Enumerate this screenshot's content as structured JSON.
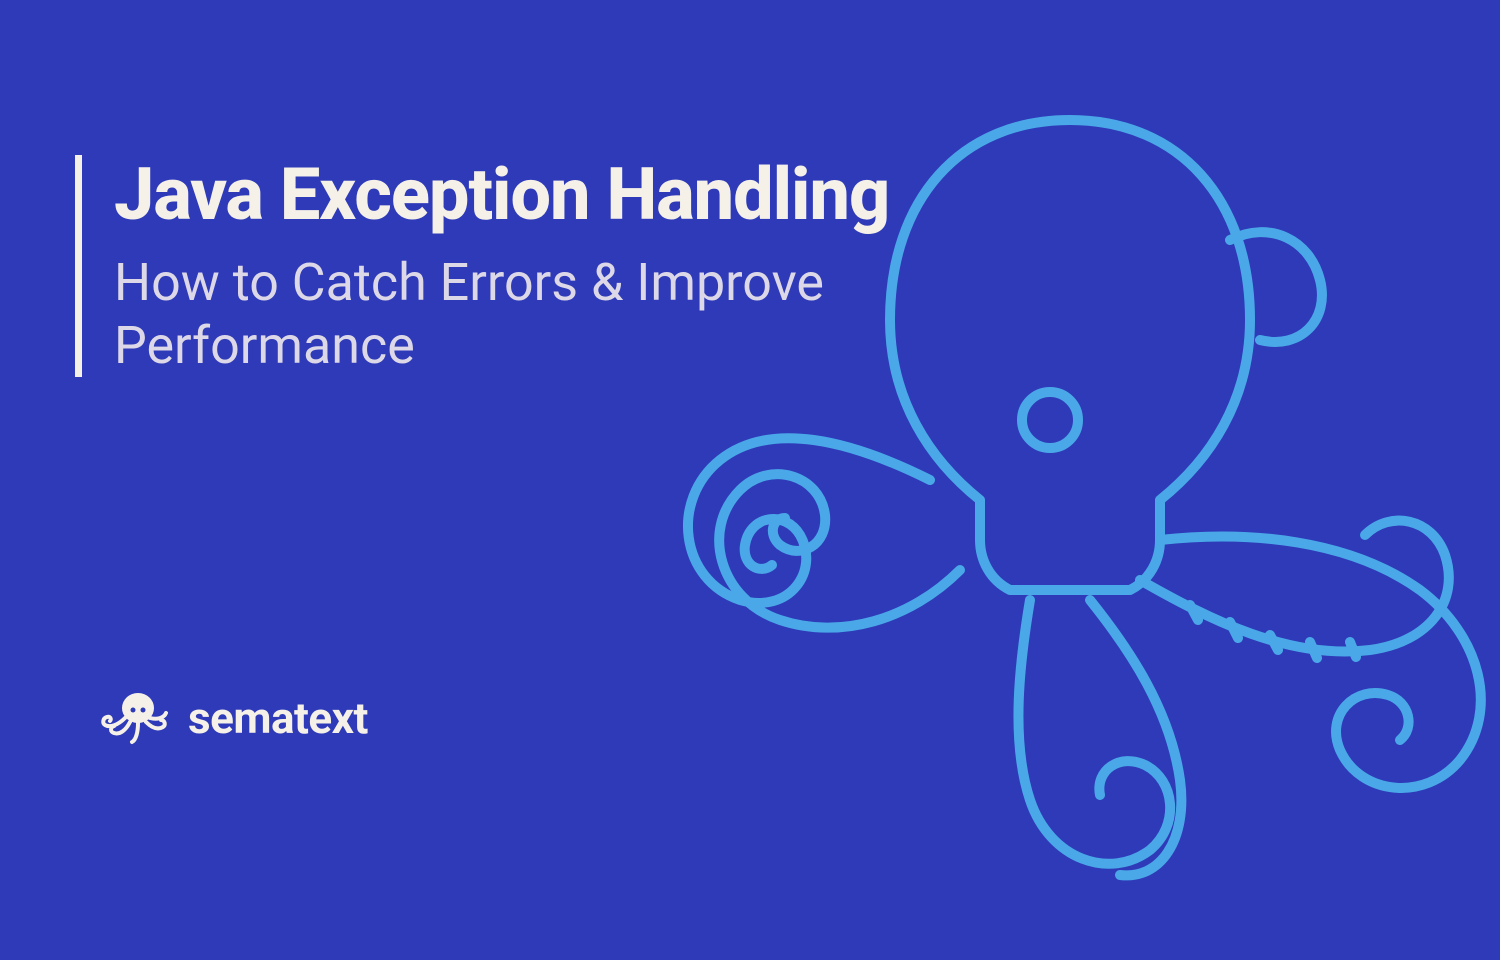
{
  "hero": {
    "title": "Java Exception Handling",
    "subtitle": "How to Catch Errors & Improve Performance"
  },
  "brand": {
    "name": "sematext"
  },
  "colors": {
    "background": "#2E3AB8",
    "octopus_outline": "#4AA8E8",
    "text_primary": "#F5F1E8",
    "text_secondary": "#DDD8E8"
  }
}
